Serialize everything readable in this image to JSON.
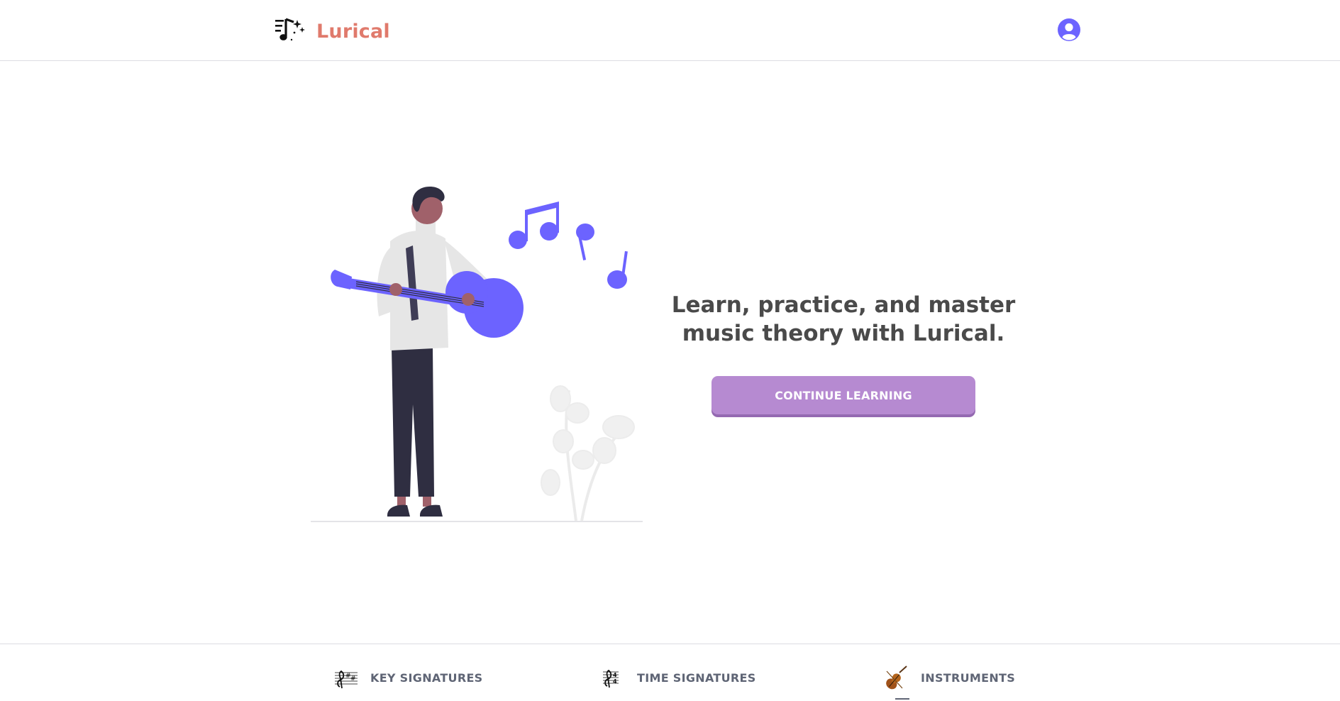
{
  "app": {
    "name": "Lurical"
  },
  "header": {
    "logo_icon": "music-notes-sparkle-icon",
    "avatar_icon": "user-avatar-icon",
    "accent_color": "#e07a6c",
    "avatar_color": "#6c63ff"
  },
  "hero": {
    "headline": "Learn, practice, and master music theory with Lurical.",
    "cta_label": "CONTINUE LEARNING",
    "cta_color": "#b68ad1",
    "illustration": "person-playing-guitar-illustration",
    "illustration_accent": "#6c63ff"
  },
  "footer_nav": {
    "items": [
      {
        "label": "KEY SIGNATURES",
        "icon": "key-signature-icon"
      },
      {
        "label": "TIME SIGNATURES",
        "icon": "time-signature-icon"
      },
      {
        "label": "INSTRUMENTS",
        "icon": "violin-icon"
      }
    ]
  }
}
